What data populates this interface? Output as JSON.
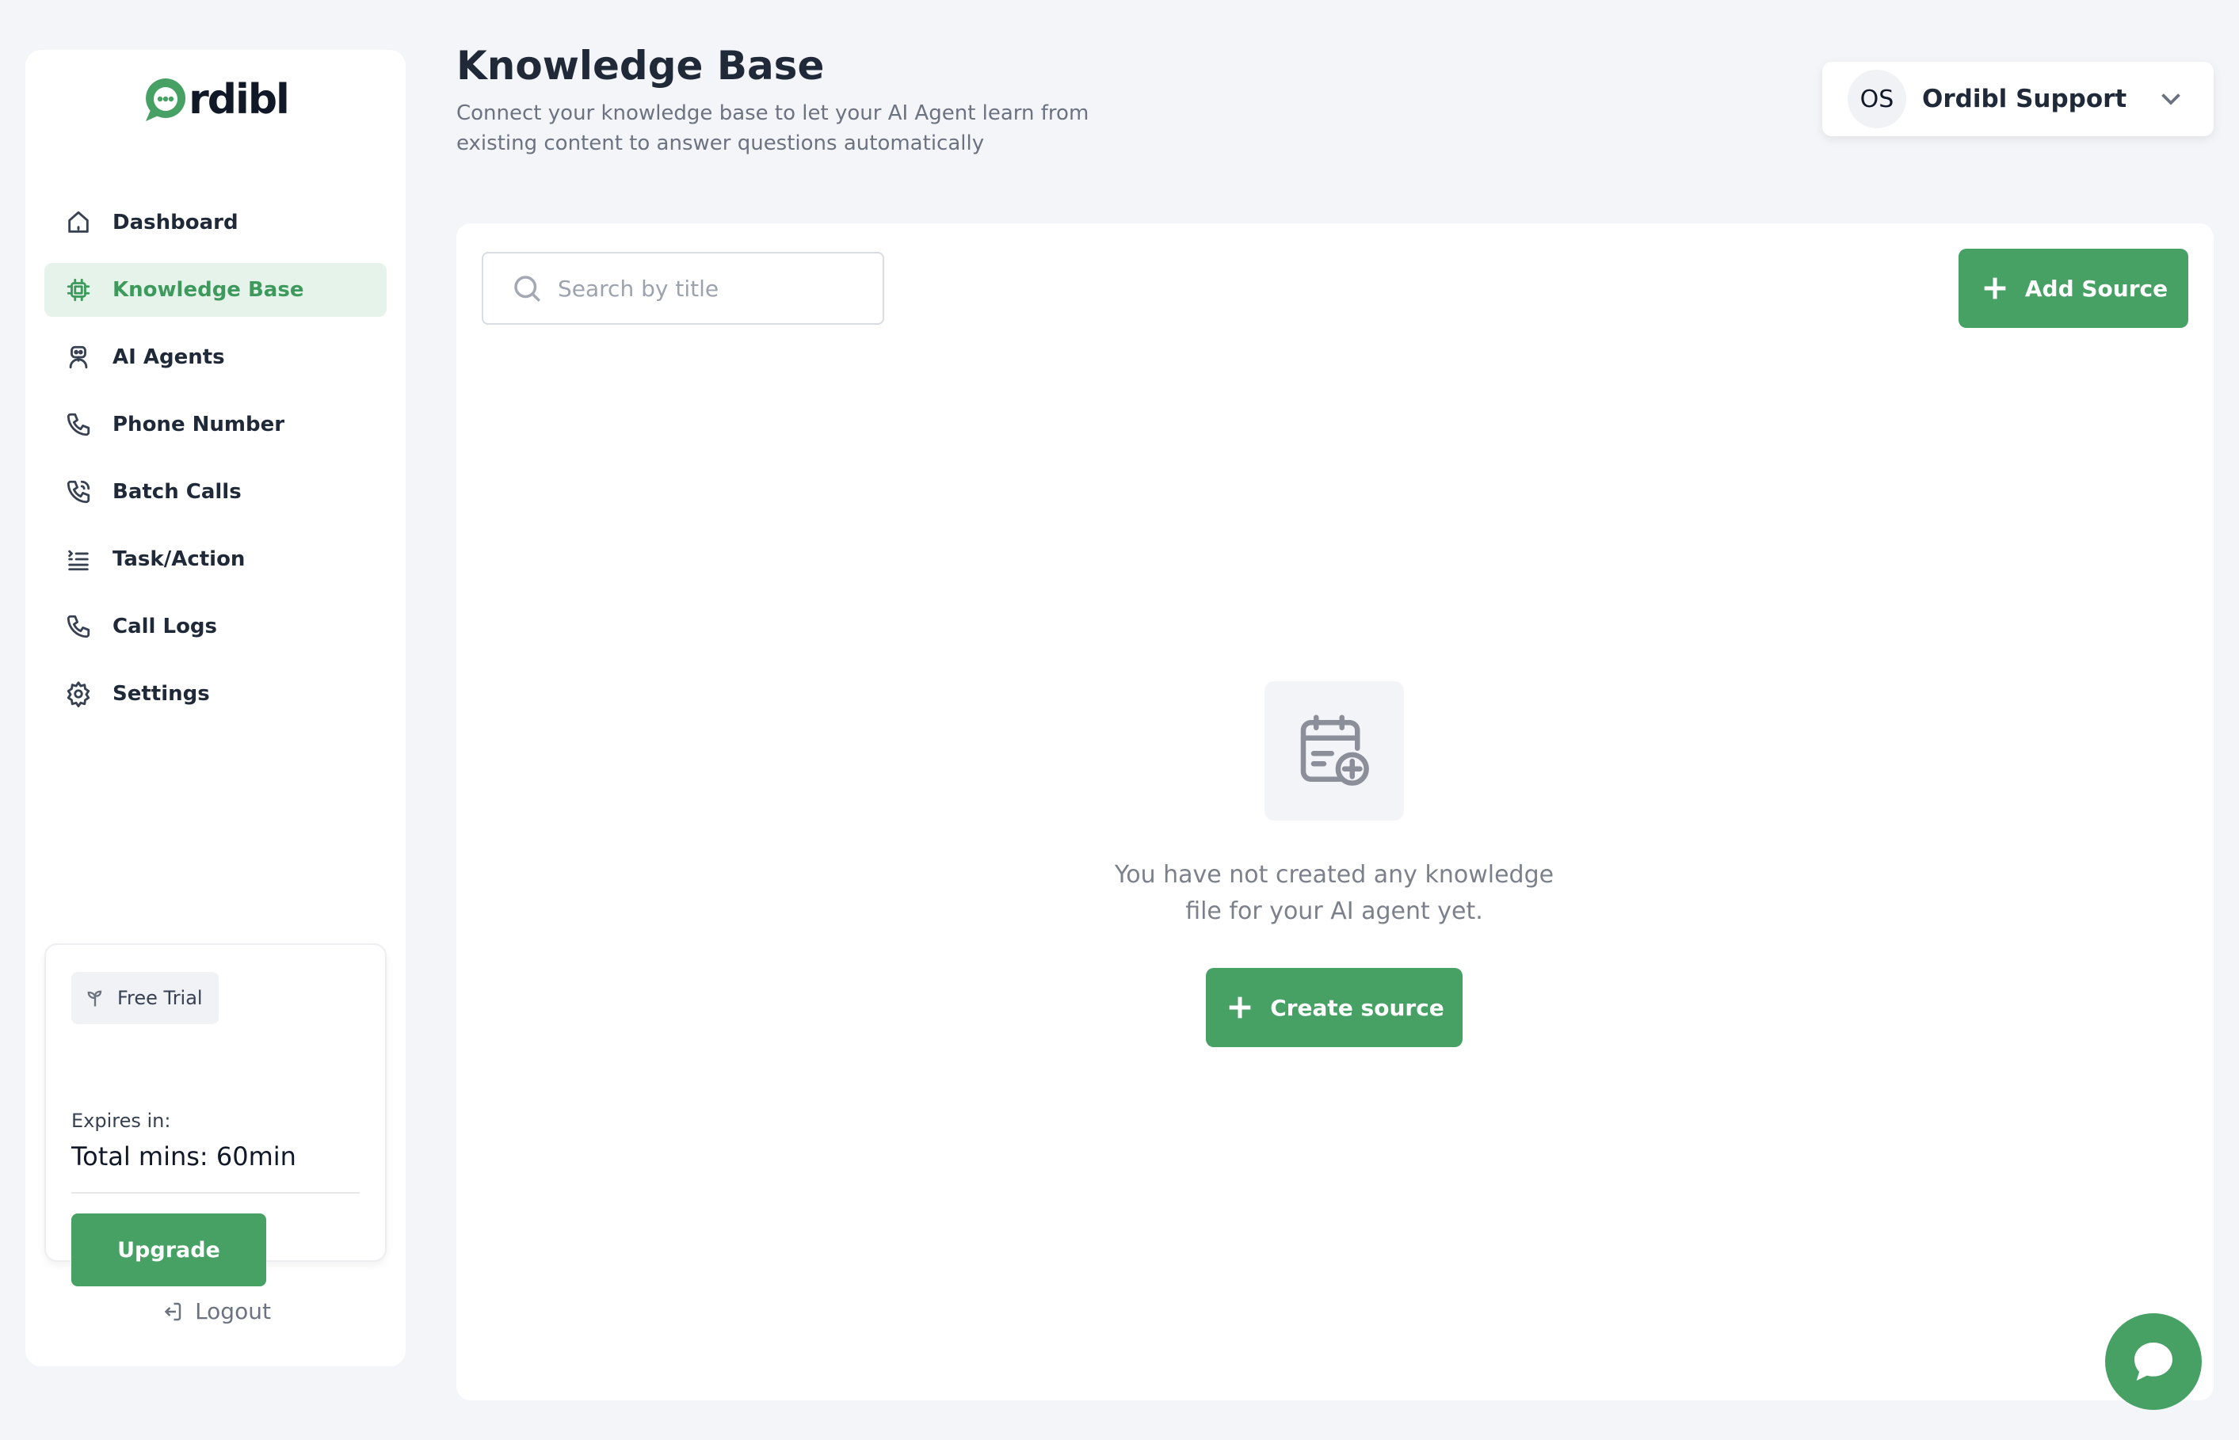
{
  "brand": {
    "logo_text": "rdibl",
    "accent": "#47a064"
  },
  "sidebar": {
    "items": [
      {
        "label": "Dashboard",
        "icon": "home-icon",
        "active": false
      },
      {
        "label": "Knowledge Base",
        "icon": "chip-icon",
        "active": true
      },
      {
        "label": "AI Agents",
        "icon": "robot-icon",
        "active": false
      },
      {
        "label": "Phone Number",
        "icon": "phone-icon",
        "active": false
      },
      {
        "label": "Batch Calls",
        "icon": "phone-call-icon",
        "active": false
      },
      {
        "label": "Task/Action",
        "icon": "task-list-icon",
        "active": false
      },
      {
        "label": "Call Logs",
        "icon": "phone-icon",
        "active": false
      },
      {
        "label": "Settings",
        "icon": "gear-icon",
        "active": false
      }
    ],
    "trial": {
      "badge": "Free Trial",
      "expires_label": "Expires in:",
      "total": "Total mins: 60min",
      "upgrade_label": "Upgrade"
    },
    "logout_label": "Logout"
  },
  "header": {
    "title": "Knowledge Base",
    "subtitle": "Connect your knowledge base to let your AI Agent learn from existing content to answer questions automatically"
  },
  "user": {
    "initials": "OS",
    "name": "Ordibl Support"
  },
  "main": {
    "search_placeholder": "Search by title",
    "add_source_label": "Add Source",
    "empty_message": "You have not created any knowledge file for your AI agent yet.",
    "create_source_label": "Create source"
  }
}
